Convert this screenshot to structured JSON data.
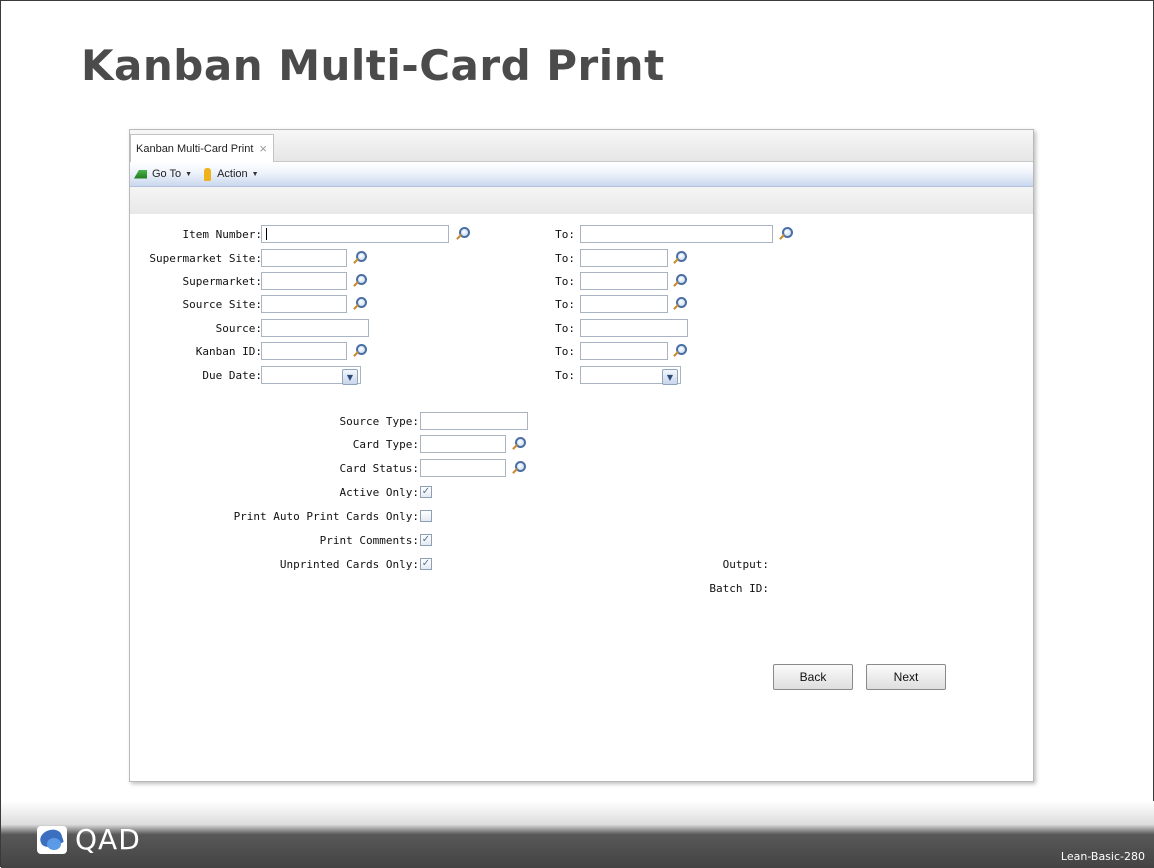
{
  "slide": {
    "title": "Kanban Multi-Card Print",
    "footer_id": "Lean-Basic-280",
    "logo_text": "QAD"
  },
  "window": {
    "tab_label": "Kanban Multi-Card Print",
    "tab_close": "×",
    "toolbar": {
      "goto_label": "Go To",
      "action_label": "Action"
    }
  },
  "range_fields": [
    {
      "label": "Item Number:",
      "to_label": "To:",
      "lookup": true
    },
    {
      "label": "Supermarket Site:",
      "to_label": "To:",
      "lookup": true
    },
    {
      "label": "Supermarket:",
      "to_label": "To:",
      "lookup": true
    },
    {
      "label": "Source Site:",
      "to_label": "To:",
      "lookup": true
    },
    {
      "label": "Source:",
      "to_label": "To:",
      "lookup": false
    },
    {
      "label": "Kanban ID:",
      "to_label": "To:",
      "lookup": true
    },
    {
      "label": "Due Date:",
      "to_label": "To:",
      "dropdown": true
    }
  ],
  "options": {
    "source_type_label": "Source Type:",
    "card_type_label": "Card Type:",
    "card_status_label": "Card Status:",
    "active_only_label": "Active Only:",
    "active_only_checked": true,
    "auto_print_label": "Print Auto Print Cards Only:",
    "auto_print_checked": false,
    "print_comments_label": "Print Comments:",
    "print_comments_checked": true,
    "unprinted_label": "Unprinted Cards Only:",
    "unprinted_checked": true,
    "output_label": "Output:",
    "batch_id_label": "Batch ID:"
  },
  "buttons": {
    "back": "Back",
    "next": "Next"
  },
  "glyphs": {
    "check": "✓",
    "dropdown": "▼",
    "caret": "▼"
  }
}
